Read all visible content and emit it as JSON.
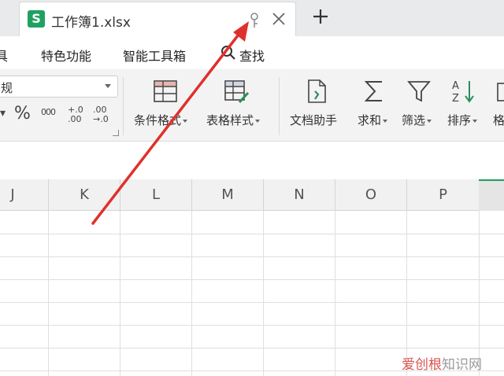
{
  "tab": {
    "logo_letter": "S",
    "title": "工作簿1.xlsx"
  },
  "menu": {
    "items": [
      "具",
      "特色功能",
      "智能工具箱",
      "查找"
    ]
  },
  "ribbon": {
    "format_value": "规",
    "number_buttons": [
      "%",
      "000",
      "+.0 .00",
      ".00 →.0"
    ],
    "buttons": [
      {
        "label": "条件格式",
        "icon": "conditional-format-icon",
        "has_caret": true
      },
      {
        "label": "表格样式",
        "icon": "table-style-icon",
        "has_caret": true
      },
      {
        "label": "文档助手",
        "icon": "doc-assistant-icon",
        "has_caret": false
      },
      {
        "label": "求和",
        "icon": "sum-icon",
        "has_caret": true
      },
      {
        "label": "筛选",
        "icon": "filter-icon",
        "has_caret": true
      },
      {
        "label": "排序",
        "icon": "sort-icon",
        "has_caret": true
      },
      {
        "label": "格",
        "icon": "format-icon",
        "has_caret": false
      }
    ]
  },
  "grid": {
    "columns": [
      "J",
      "K",
      "L",
      "M",
      "N",
      "O",
      "P",
      ""
    ]
  },
  "watermark": {
    "part1": "爱创根",
    "part2": "知识网"
  },
  "colors": {
    "accent_green": "#20a162",
    "arrow_red": "#e0302c"
  }
}
